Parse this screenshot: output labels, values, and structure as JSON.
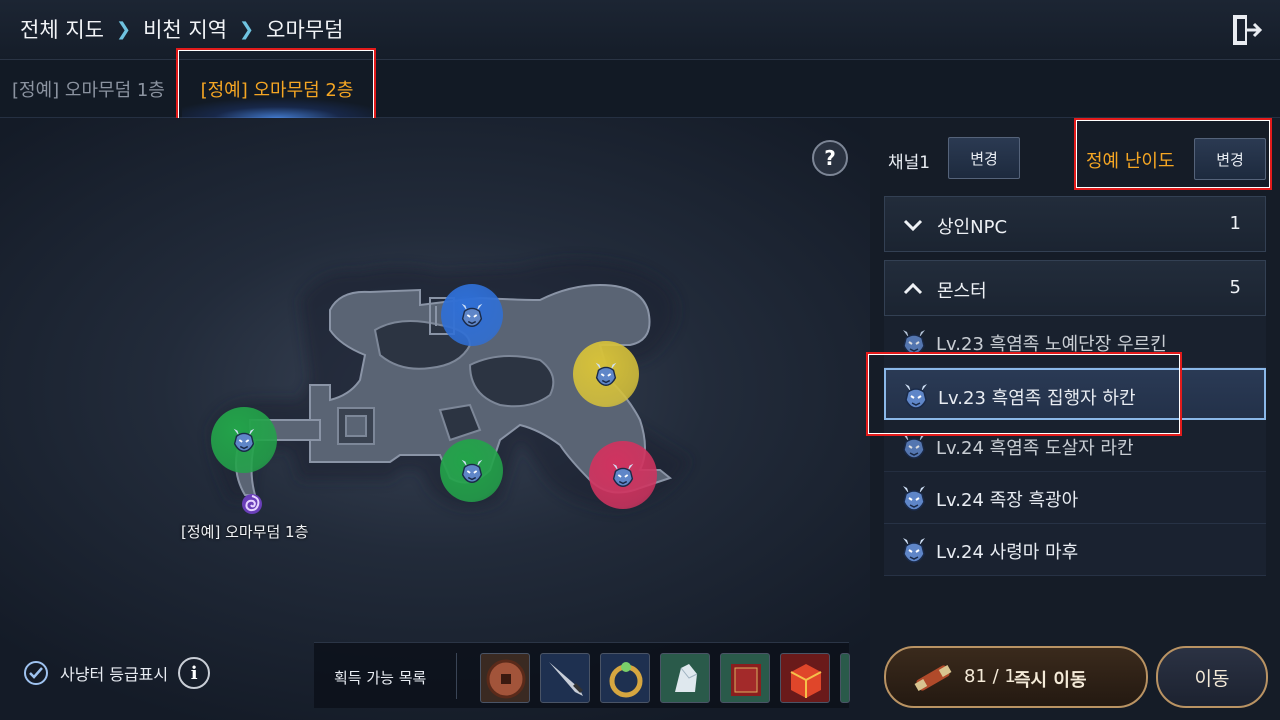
{
  "breadcrumb": {
    "items": [
      "전체 지도",
      "비천 지역",
      "오마무덤"
    ]
  },
  "tabs": [
    {
      "label": "[정예] 오마무덤 1층",
      "active": false
    },
    {
      "label": "[정예] 오마무덤 2층",
      "active": true
    }
  ],
  "map": {
    "portal_label": "[정예] 오마무덤 1층",
    "markers": [
      {
        "color": "#2f6fd6",
        "type": "boss-icon"
      },
      {
        "color": "#d6c13a",
        "type": "boss-icon"
      },
      {
        "color": "#23a34a",
        "type": "boss-icon"
      },
      {
        "color": "#23a34a",
        "type": "boss-icon"
      },
      {
        "color": "#d0335f",
        "type": "boss-icon"
      }
    ]
  },
  "bottom": {
    "grade_label": "사냥터 등급표시",
    "grade_checked": true,
    "loot_label": "획득 가능 목록",
    "loot_items": [
      "coin-icon",
      "dagger-icon",
      "dragon-ring-icon",
      "crystal-icon",
      "book-icon",
      "box-icon"
    ]
  },
  "panel": {
    "channel_label": "채널1",
    "channel_button": "변경",
    "difficulty_label": "정예 난이도",
    "difficulty_button": "변경",
    "sections": [
      {
        "title": "상인NPC",
        "count": "1",
        "expanded": false
      },
      {
        "title": "몬스터",
        "count": "5",
        "expanded": true
      }
    ],
    "monsters": [
      {
        "name": "Lv.23 흑염족 노예단장 우르킨",
        "selected": false
      },
      {
        "name": "Lv.23 흑염족 집행자 하칸",
        "selected": true
      },
      {
        "name": "Lv.24 흑염족 도살자 라칸",
        "selected": false
      },
      {
        "name": "Lv.24 족장 흑광아",
        "selected": false
      },
      {
        "name": "Lv.24 사령마 마후",
        "selected": false
      }
    ],
    "teleport": {
      "count": "81 /  1",
      "label": "즉시 이동"
    },
    "move_button": "이동"
  },
  "colors": {
    "accent": "#f5a623",
    "highlight": "#e21b1b",
    "selected_border": "#8bb8e8"
  }
}
